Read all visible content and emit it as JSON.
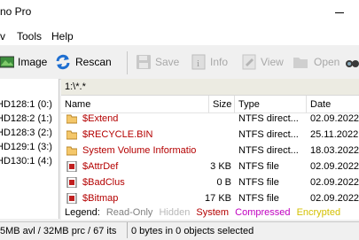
{
  "window": {
    "title": "no Pro"
  },
  "menu": {
    "items": [
      "v",
      "Tools",
      "Help"
    ]
  },
  "toolbar": {
    "image": "Image",
    "rescan": "Rescan",
    "save": "Save",
    "info": "Info",
    "view": "View",
    "open": "Open"
  },
  "volumes": [
    "HD128:1 (0:)",
    "HD128:2 (1:)",
    "HD128:3 (2:)",
    "HD129:1 (3:)",
    "HD130:1 (4:)"
  ],
  "path": "1:\\*.*",
  "columns": {
    "name": "Name",
    "size": "Size",
    "type": "Type",
    "date": "Date"
  },
  "files": [
    {
      "name": "$Extend",
      "size": "",
      "type": "NTFS direct...",
      "date": "02.09.2022"
    },
    {
      "name": "$RECYCLE.BIN",
      "size": "",
      "type": "NTFS direct...",
      "date": "25.11.2022"
    },
    {
      "name": "System Volume Information",
      "size": "",
      "type": "NTFS direct...",
      "date": "18.03.2022"
    },
    {
      "name": "$AttrDef",
      "size": "3 KB",
      "type": "NTFS file",
      "date": "02.09.2022"
    },
    {
      "name": "$BadClus",
      "size": "0 B",
      "type": "NTFS file",
      "date": "02.09.2022"
    },
    {
      "name": "$Bitmap",
      "size": "17 KB",
      "type": "NTFS file",
      "date": "02.09.2022"
    }
  ],
  "legend": {
    "label": "Legend:",
    "readonly": "Read-Only",
    "hidden": "Hidden",
    "system": "System",
    "compressed": "Compressed",
    "encrypted": "Encrypted"
  },
  "status": {
    "memory": "5MB avl / 32MB prc / 67 its",
    "selection": "0 bytes in 0 objects selected"
  },
  "colors": {
    "system": "#b40000",
    "compressed": "#c000c0",
    "encrypted": "#d4c000",
    "hidden": "#b8b8b8",
    "readonly": "#808080"
  }
}
